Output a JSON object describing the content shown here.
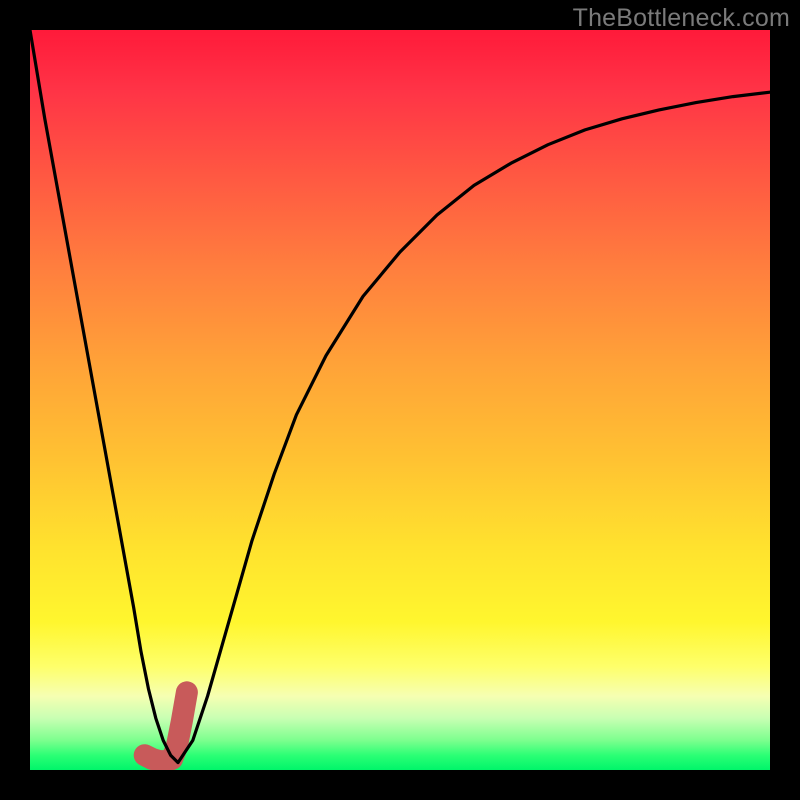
{
  "watermark": "TheBottleneck.com",
  "colors": {
    "background": "#000000",
    "curve": "#000000",
    "highlight": "#c85a5a",
    "gradient_stops": [
      "#ff1a3a",
      "#ff7e3e",
      "#ffe22e",
      "#feff6a",
      "#00f56a"
    ]
  },
  "chart_data": {
    "type": "line",
    "title": "",
    "xlabel": "",
    "ylabel": "",
    "xlim": [
      0,
      100
    ],
    "ylim": [
      0,
      100
    ],
    "grid": false,
    "legend": false,
    "x": [
      0,
      2,
      4,
      6,
      8,
      10,
      12,
      14,
      15,
      16,
      17,
      18,
      19,
      20,
      22,
      24,
      26,
      28,
      30,
      33,
      36,
      40,
      45,
      50,
      55,
      60,
      65,
      70,
      75,
      80,
      85,
      90,
      95,
      100
    ],
    "values": [
      100,
      88,
      77,
      66,
      55,
      44,
      33,
      22,
      16,
      11,
      7,
      4,
      2,
      1,
      4,
      10,
      17,
      24,
      31,
      40,
      48,
      56,
      64,
      70,
      75,
      79,
      82,
      84.5,
      86.5,
      88,
      89.2,
      90.2,
      91,
      91.6
    ],
    "note": "y is plotted with 100 at top, 0 at bottom (inverted on screen). Values are approximate readings from the figure.",
    "highlight_segment": {
      "x": [
        15.5,
        16.5,
        17.5,
        18.5,
        19.2,
        19.8,
        20.5,
        21.2
      ],
      "values": [
        2.0,
        1.5,
        1.2,
        1.2,
        1.5,
        3.0,
        6.5,
        10.5
      ],
      "stroke_width_px": 22,
      "color": "#c85a5a"
    }
  }
}
